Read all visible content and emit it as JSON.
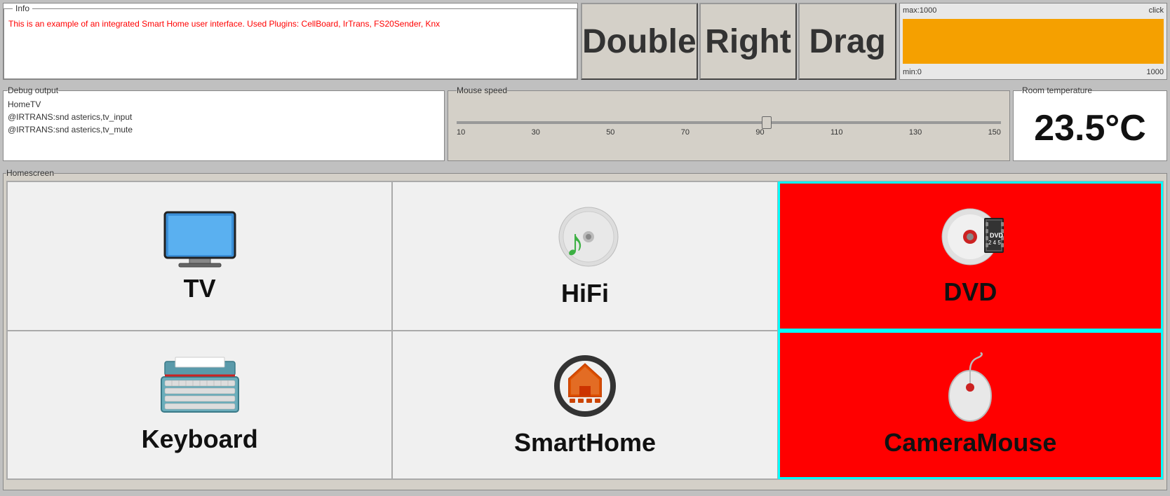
{
  "info": {
    "legend": "Info",
    "text": "This is an example of an integrated Smart Home user interface.  Used Plugins: CellBoard, IrTrans, FS20Sender, Knx"
  },
  "buttons": {
    "double_label": "Double",
    "right_label": "Right",
    "drag_label": "Drag"
  },
  "slider_value": {
    "max_label": "max:1000",
    "min_label": "min:0",
    "click_label": "click",
    "value": "1000"
  },
  "debug": {
    "legend": "Debug output",
    "lines": "HomeTV\n@IRTRANS:snd asterics,tv_input\n@IRTRANS:snd asterics,tv_mute"
  },
  "mouse_speed": {
    "legend": "Mouse speed",
    "value": 90,
    "labels": [
      "10",
      "30",
      "50",
      "70",
      "90",
      "110",
      "130",
      "150"
    ]
  },
  "room_temp": {
    "legend": "Room temperature",
    "value": "23.5°C"
  },
  "homescreen": {
    "legend": "Homescreen",
    "cells": [
      {
        "id": "tv",
        "label": "TV",
        "active": false
      },
      {
        "id": "hifi",
        "label": "HiFi",
        "active": false
      },
      {
        "id": "dvd",
        "label": "DVD",
        "active": true
      },
      {
        "id": "keyboard",
        "label": "Keyboard",
        "active": false
      },
      {
        "id": "smarthome",
        "label": "SmartHome",
        "active": false
      },
      {
        "id": "cameramouse",
        "label": "CameraMouse",
        "active": true
      }
    ]
  }
}
